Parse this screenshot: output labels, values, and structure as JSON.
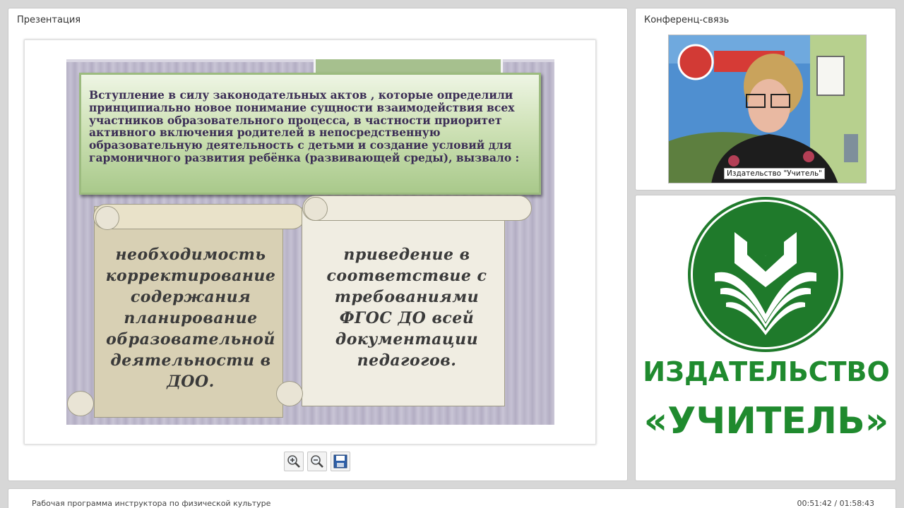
{
  "presentation": {
    "title": "Презентация",
    "slide": {
      "heading_text": "Вступление в силу законодательных актов , которые определили принципиально новое понимание сущности взаимодействия всех участников образовательного процесса, в частности приоритет активного включения родителей в непосредственную образовательную деятельность с детьми и создание условий для гармоничного развития ребёнка (развивающей среды), вызвало :",
      "left_scroll_lines": [
        "необходимость",
        "корректирование",
        "содержания",
        "планирование",
        "образовательной",
        "деятельности в",
        "ДОО."
      ],
      "right_scroll_lines": [
        "приведение в",
        "соответствие с",
        "требованиями",
        "ФГОС  ДО всей",
        "документации",
        "педагогов."
      ]
    },
    "toolbar": [
      {
        "icon": "zoom-in-icon"
      },
      {
        "icon": "zoom-out-icon"
      },
      {
        "icon": "save-icon"
      }
    ]
  },
  "conference": {
    "title": "Конференц-связь",
    "video_label": "Издательство \"Учитель\""
  },
  "logo": {
    "line1": "ИЗДАТЕЛЬСТВО",
    "line2": "«УЧИТЕЛЬ»",
    "color": "#1f7a2b"
  },
  "footer": {
    "title": "Рабочая программа инструктора по физической культуре",
    "time": "00:51:42 / 01:58:43"
  }
}
